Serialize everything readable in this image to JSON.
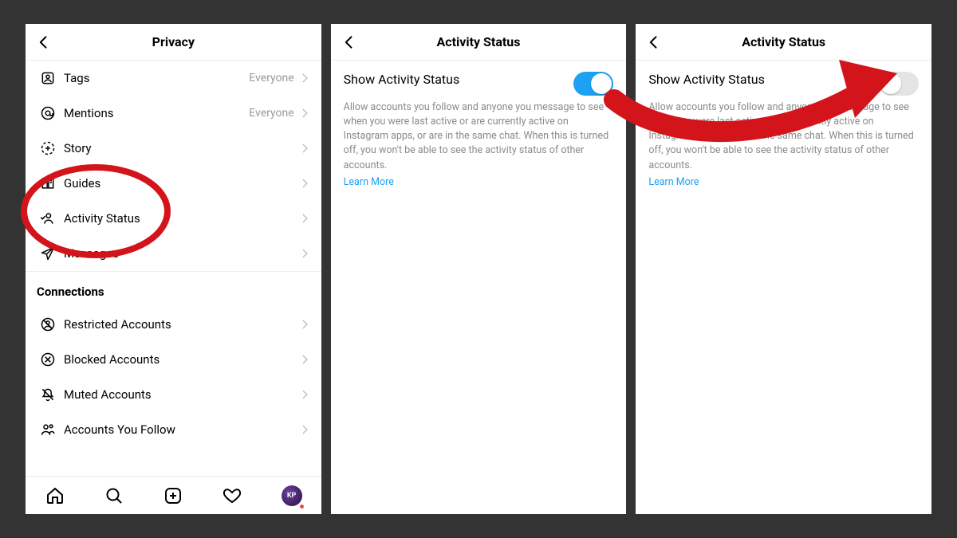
{
  "screen1": {
    "title": "Privacy",
    "items": [
      {
        "label": "Tags",
        "value": "Everyone"
      },
      {
        "label": "Mentions",
        "value": "Everyone"
      },
      {
        "label": "Story",
        "value": ""
      },
      {
        "label": "Guides",
        "value": ""
      },
      {
        "label": "Activity Status",
        "value": ""
      },
      {
        "label": "Messages",
        "value": ""
      }
    ],
    "connections_header": "Connections",
    "connections": [
      {
        "label": "Restricted Accounts"
      },
      {
        "label": "Blocked Accounts"
      },
      {
        "label": "Muted Accounts"
      },
      {
        "label": "Accounts You Follow"
      }
    ],
    "avatar_initials": "KP"
  },
  "screen2": {
    "title": "Activity Status",
    "setting_title": "Show Activity Status",
    "description": "Allow accounts you follow and anyone you message to see when you were last active or are currently active on Instagram apps, or are in the same chat. When this is turned off, you won't be able to see the activity status of other accounts.",
    "learn_more": "Learn More",
    "toggle_on": true
  },
  "screen3": {
    "title": "Activity Status",
    "setting_title": "Show Activity Status",
    "description": "Allow accounts you follow and anyone you message to see when you were last active or are currently active on Instagram apps, or are in the same chat. When this is turned off, you won't be able to see the activity status of other accounts.",
    "learn_more": "Learn More",
    "toggle_on": false
  },
  "annotations": {
    "circle_target": "Activity Status row",
    "arrow_target": "Toggle (off state)"
  }
}
